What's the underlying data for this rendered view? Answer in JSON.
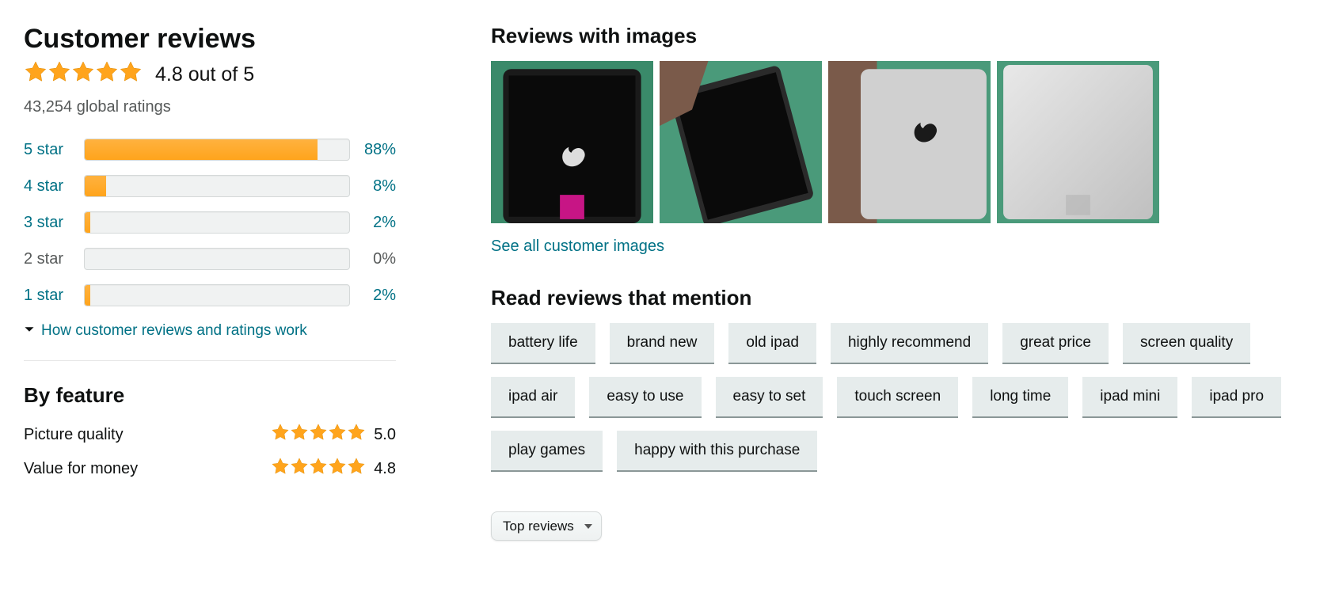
{
  "left": {
    "title": "Customer reviews",
    "rating_text": "4.8 out of 5",
    "stars_filled": 5,
    "global_ratings": "43,254 global ratings",
    "histogram": [
      {
        "label": "5 star",
        "pct": 88,
        "pct_text": "88%",
        "disabled": false
      },
      {
        "label": "4 star",
        "pct": 8,
        "pct_text": "8%",
        "disabled": false
      },
      {
        "label": "3 star",
        "pct": 2,
        "pct_text": "2%",
        "disabled": false
      },
      {
        "label": "2 star",
        "pct": 0,
        "pct_text": "0%",
        "disabled": true
      },
      {
        "label": "1 star",
        "pct": 2,
        "pct_text": "2%",
        "disabled": false
      }
    ],
    "how_link": "How customer reviews and ratings work",
    "by_feature_title": "By feature",
    "features": [
      {
        "label": "Picture quality",
        "score": "5.0",
        "stars": 5
      },
      {
        "label": "Value for money",
        "score": "4.8",
        "stars": 5
      }
    ]
  },
  "right": {
    "images_title": "Reviews with images",
    "see_all": "See all customer images",
    "mentions_title": "Read reviews that mention",
    "mentions": [
      "battery life",
      "brand new",
      "old ipad",
      "highly recommend",
      "great price",
      "screen quality",
      "ipad air",
      "easy to use",
      "easy to set",
      "touch screen",
      "long time",
      "ipad mini",
      "ipad pro",
      "play games",
      "happy with this purchase"
    ],
    "sort_selected": "Top reviews"
  }
}
